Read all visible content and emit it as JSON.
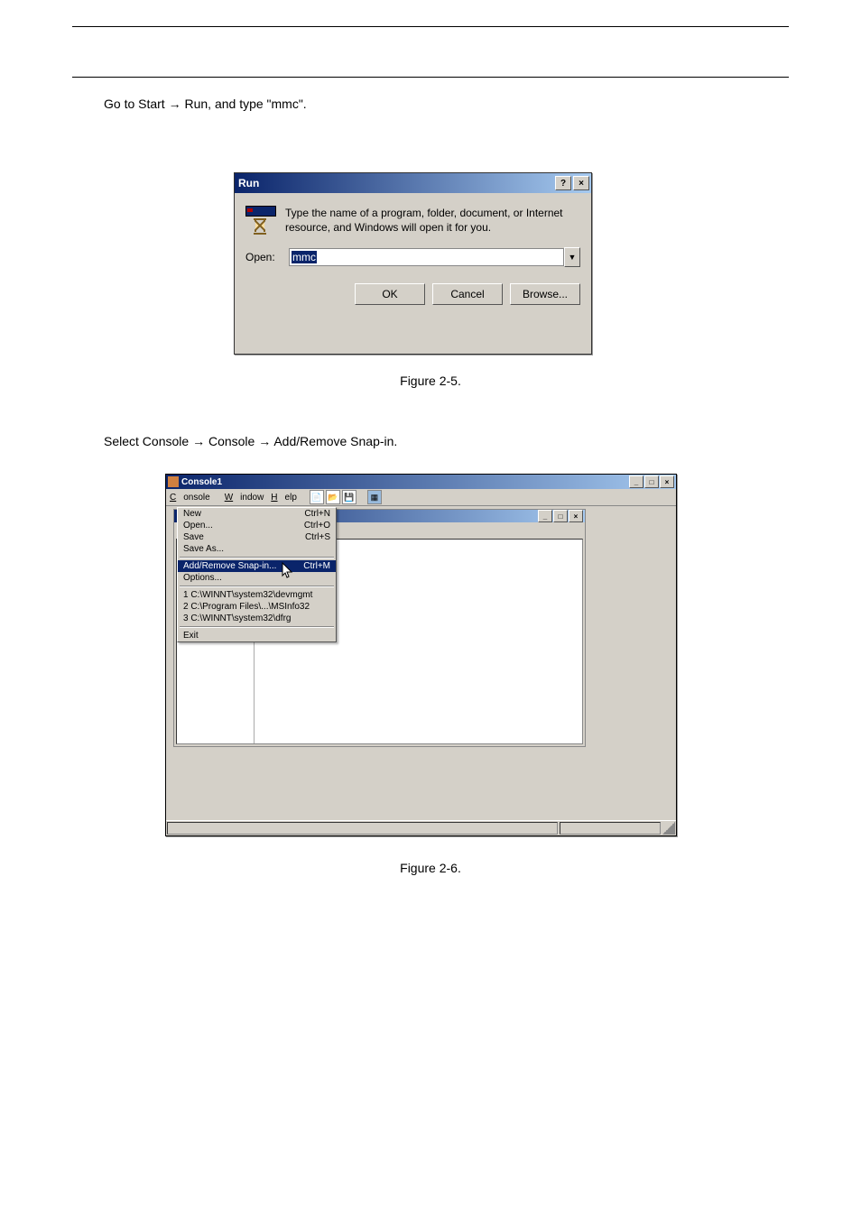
{
  "step1": {
    "prefix": "Go to Start ",
    "rest": " Run, and type \"mmc\"."
  },
  "run_dialog": {
    "title": "Run",
    "help": "?",
    "close": "×",
    "description": "Type the name of a program, folder, document, or Internet resource, and Windows will open it for you.",
    "open_label": "Open:",
    "input_value": "mmc",
    "buttons": {
      "ok": "OK",
      "cancel": "Cancel",
      "browse": "Browse..."
    }
  },
  "caption1": "Figure 2-5.",
  "step2": {
    "prefix": "Select Console ",
    "mid": " Console ",
    "mid2": " Add/Remove Snap-in."
  },
  "console": {
    "title": "Console1",
    "minimize": "_",
    "maximize": "□",
    "close": "×",
    "menubar": {
      "console": "Console",
      "window": "Window",
      "help": "Help"
    },
    "menu": {
      "new": {
        "label": "New",
        "shortcut": "Ctrl+N"
      },
      "open": {
        "label": "Open...",
        "shortcut": "Ctrl+O"
      },
      "save": {
        "label": "Save",
        "shortcut": "Ctrl+S"
      },
      "saveas": {
        "label": "Save As..."
      },
      "addrem": {
        "label": "Add/Remove Snap-in...",
        "shortcut": "Ctrl+M"
      },
      "options": {
        "label": "Options..."
      },
      "recent1": "1 C:\\WINNT\\system32\\devmgmt",
      "recent2": "2 C:\\Program Files\\...\\MSInfo32",
      "recent3": "3 C:\\WINNT\\system32\\dfrg",
      "exit": "Exit"
    },
    "inner": {
      "minimize": "_",
      "maximize": "□",
      "close": "×"
    }
  },
  "caption2": "Figure 2-6."
}
